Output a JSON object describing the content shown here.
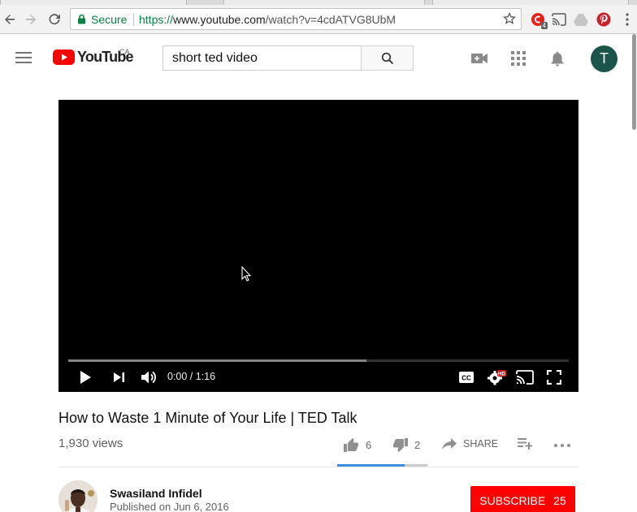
{
  "browser": {
    "secure_label": "Secure",
    "url_protocol": "https://",
    "url_host": "www.youtube.com",
    "url_path": "/watch?v=4cdATVG8UbM",
    "extension_badge": "4",
    "icons": [
      "back-icon",
      "forward-icon",
      "reload-icon",
      "lock-icon",
      "star-icon",
      "extension-icon",
      "cast-icon",
      "drive-icon",
      "pinterest-icon"
    ]
  },
  "header": {
    "logo_text": "YouTube",
    "country": "CA",
    "search_value": "short ted video",
    "search_placeholder": "Search",
    "avatar_letter": "T",
    "icons": [
      "menu-icon",
      "create-video-icon",
      "apps-icon",
      "notifications-icon"
    ]
  },
  "player": {
    "time": "0:00 / 1:16",
    "buffered_fraction": 0.596,
    "quality_badge": "HD",
    "icons": [
      "play-icon",
      "next-icon",
      "volume-icon",
      "captions-icon",
      "settings-icon",
      "cast-icon",
      "fullscreen-icon"
    ]
  },
  "video": {
    "title": "How to Waste 1 Minute of Your Life | TED Talk",
    "views": "1,930 views",
    "likes": "6",
    "dislikes": "2",
    "share_label": "SHARE",
    "like_fraction": 0.75
  },
  "channel": {
    "name": "Swasiland Infidel",
    "published": "Published on Jun 6, 2016",
    "subscribe_label": "SUBSCRIBE",
    "subscriber_count": "25"
  },
  "colors": {
    "brand_red": "#ff0000",
    "secure_green": "#0b8043",
    "avatar_bg": "#1b5448",
    "like_bar": "#3a8ee6"
  }
}
